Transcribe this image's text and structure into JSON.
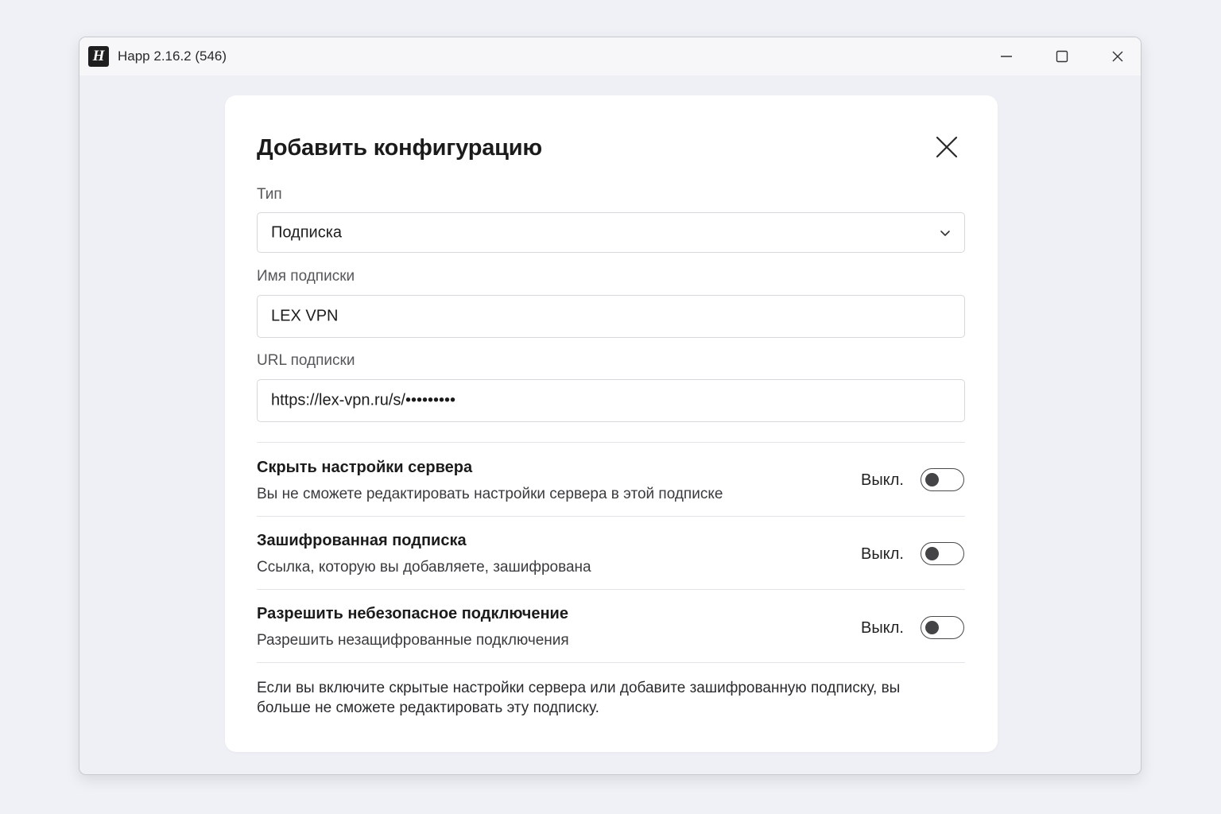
{
  "window": {
    "title": "Happ 2.16.2 (546)",
    "logo_letter": "H"
  },
  "dialog": {
    "title": "Добавить конфигурацию",
    "type": {
      "label": "Тип",
      "value": "Подписка"
    },
    "name": {
      "label": "Имя подписки",
      "value": "LEX VPN"
    },
    "url": {
      "label": "URL подписки",
      "value": "https://lex-vpn.ru/s/•••••••••"
    },
    "options": [
      {
        "title": "Скрыть настройки сервера",
        "description": "Вы не сможете редактировать настройки сервера в этой подписке",
        "state": "Выкл.",
        "enabled": false
      },
      {
        "title": "Зашифрованная подписка",
        "description": "Ссылка, которую вы добавляете, зашифрована",
        "state": "Выкл.",
        "enabled": false
      },
      {
        "title": "Разрешить небезопасное подключение",
        "description": "Разрешить незащифрованные подключения",
        "state": "Выкл.",
        "enabled": false
      }
    ],
    "footnote": "Если вы включите скрытые настройки сервера или добавите зашифрованную подписку, вы больше не сможете редактировать эту подписку."
  },
  "colors": {
    "background": "#eff1f7",
    "dialog": "#ffffff",
    "border": "#d7d8dc",
    "toggle_off": "#444446"
  },
  "icons": {
    "minimize": "minimize-icon",
    "maximize": "maximize-icon",
    "close": "close-icon",
    "dropdown": "chevron-down-icon"
  }
}
